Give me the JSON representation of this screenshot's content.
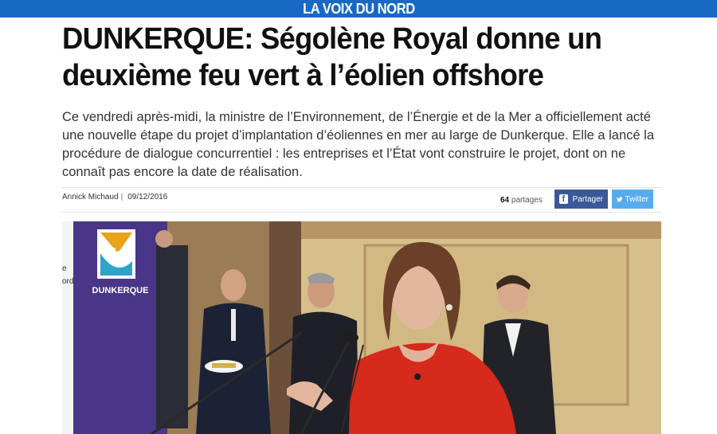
{
  "header": {
    "logo_text": "LA VOIX DU NORD",
    "brand_color": "#1769c4"
  },
  "article": {
    "headline": "DUNKERQUE: Ségolène Royal donne un deuxième feu vert à l’éolien offshore",
    "lead": "Ce vendredi après-midi, la ministre de l’Environnement, de l’Énergie et de la Mer a officiellement acté une nouvelle étape du projet d’implantation d’éoliennes en mer au large de Dunkerque. Elle a lancé la procédure de dialogue concurrentiel : les entreprises et l’État vont construire le projet, dont on ne connaît pas encore la date de réalisation.",
    "author": "Annick Michaud",
    "date": "09/12/2016",
    "byline_separator": "|"
  },
  "share": {
    "count": "64",
    "count_label": "partages",
    "facebook_label": "Partager",
    "facebook_icon": "facebook-icon",
    "facebook_color": "#3b5998",
    "twitter_label": "Twitter",
    "twitter_icon": "twitter-icon",
    "twitter_color": "#55acee"
  },
  "photo": {
    "banner_text": "DUNKERQUE",
    "banner_letter": "k",
    "side_text_lines": [
      "e",
      "ord"
    ]
  }
}
